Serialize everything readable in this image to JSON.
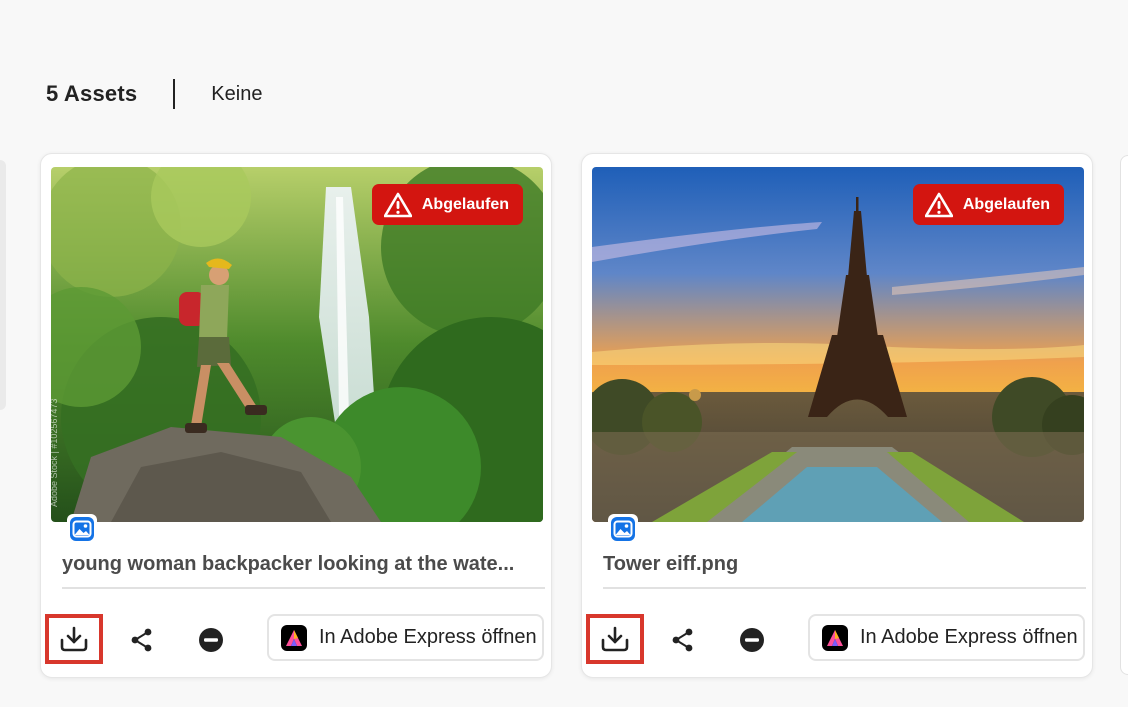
{
  "header": {
    "asset_count": "5 Assets",
    "filter_label": "Keine"
  },
  "colors": {
    "expired_badge": "#d31510",
    "highlight": "#d8372c"
  },
  "cards": [
    {
      "expired_label": "Abgelaufen",
      "file_type_icon": "image-icon",
      "title": "young woman backpacker looking at the wate...",
      "open_label": "In Adobe Express öffnen"
    },
    {
      "expired_label": "Abgelaufen",
      "file_type_icon": "image-icon",
      "title": "Tower eiff.png",
      "open_label": "In Adobe Express öffnen"
    }
  ]
}
